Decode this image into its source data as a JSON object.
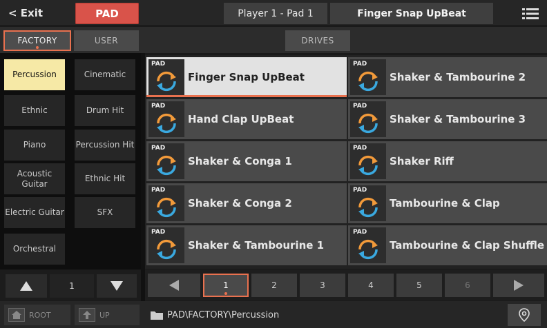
{
  "header": {
    "exit_label": "< Exit",
    "mode_label": "PAD",
    "player_label": "Player 1 - Pad 1",
    "current_name": "Finger Snap UpBeat",
    "menu_icon": "list-menu-icon"
  },
  "tabs": {
    "factory": "FACTORY",
    "user": "USER",
    "drives": "DRIVES"
  },
  "categories": [
    {
      "label": "Percussion",
      "selected": true
    },
    {
      "label": "Cinematic"
    },
    {
      "label": "Ethnic"
    },
    {
      "label": "Drum Hit"
    },
    {
      "label": "Piano"
    },
    {
      "label": "Percussion Hit"
    },
    {
      "label": "Acoustic Guitar"
    },
    {
      "label": "Ethnic Hit"
    },
    {
      "label": "Electric Guitar"
    },
    {
      "label": "SFX"
    },
    {
      "label": "Orchestral"
    }
  ],
  "category_page": "1",
  "pads": [
    {
      "tag": "PAD",
      "name": "Finger Snap UpBeat",
      "selected": true
    },
    {
      "tag": "PAD",
      "name": "Shaker & Tambourine 2"
    },
    {
      "tag": "PAD",
      "name": "Hand Clap UpBeat"
    },
    {
      "tag": "PAD",
      "name": "Shaker & Tambourine 3"
    },
    {
      "tag": "PAD",
      "name": "Shaker & Conga 1"
    },
    {
      "tag": "PAD",
      "name": "Shaker Riff"
    },
    {
      "tag": "PAD",
      "name": "Shaker & Conga 2"
    },
    {
      "tag": "PAD",
      "name": "Tambourine & Clap"
    },
    {
      "tag": "PAD",
      "name": "Shaker & Tambourine 1"
    },
    {
      "tag": "PAD",
      "name": "Tambourine & Clap Shuffle"
    }
  ],
  "pages": [
    "1",
    "2",
    "3",
    "4",
    "5",
    "6"
  ],
  "current_page": "1",
  "footer": {
    "root_label": "ROOT",
    "up_label": "UP",
    "path": "PAD\\FACTORY\\Percussion"
  },
  "colors": {
    "accent": "#e9714f",
    "mode_red": "#d9534a",
    "selected_category": "#f6e9a6",
    "loop_orange": "#f29a3a",
    "loop_blue": "#3aa9e0"
  }
}
